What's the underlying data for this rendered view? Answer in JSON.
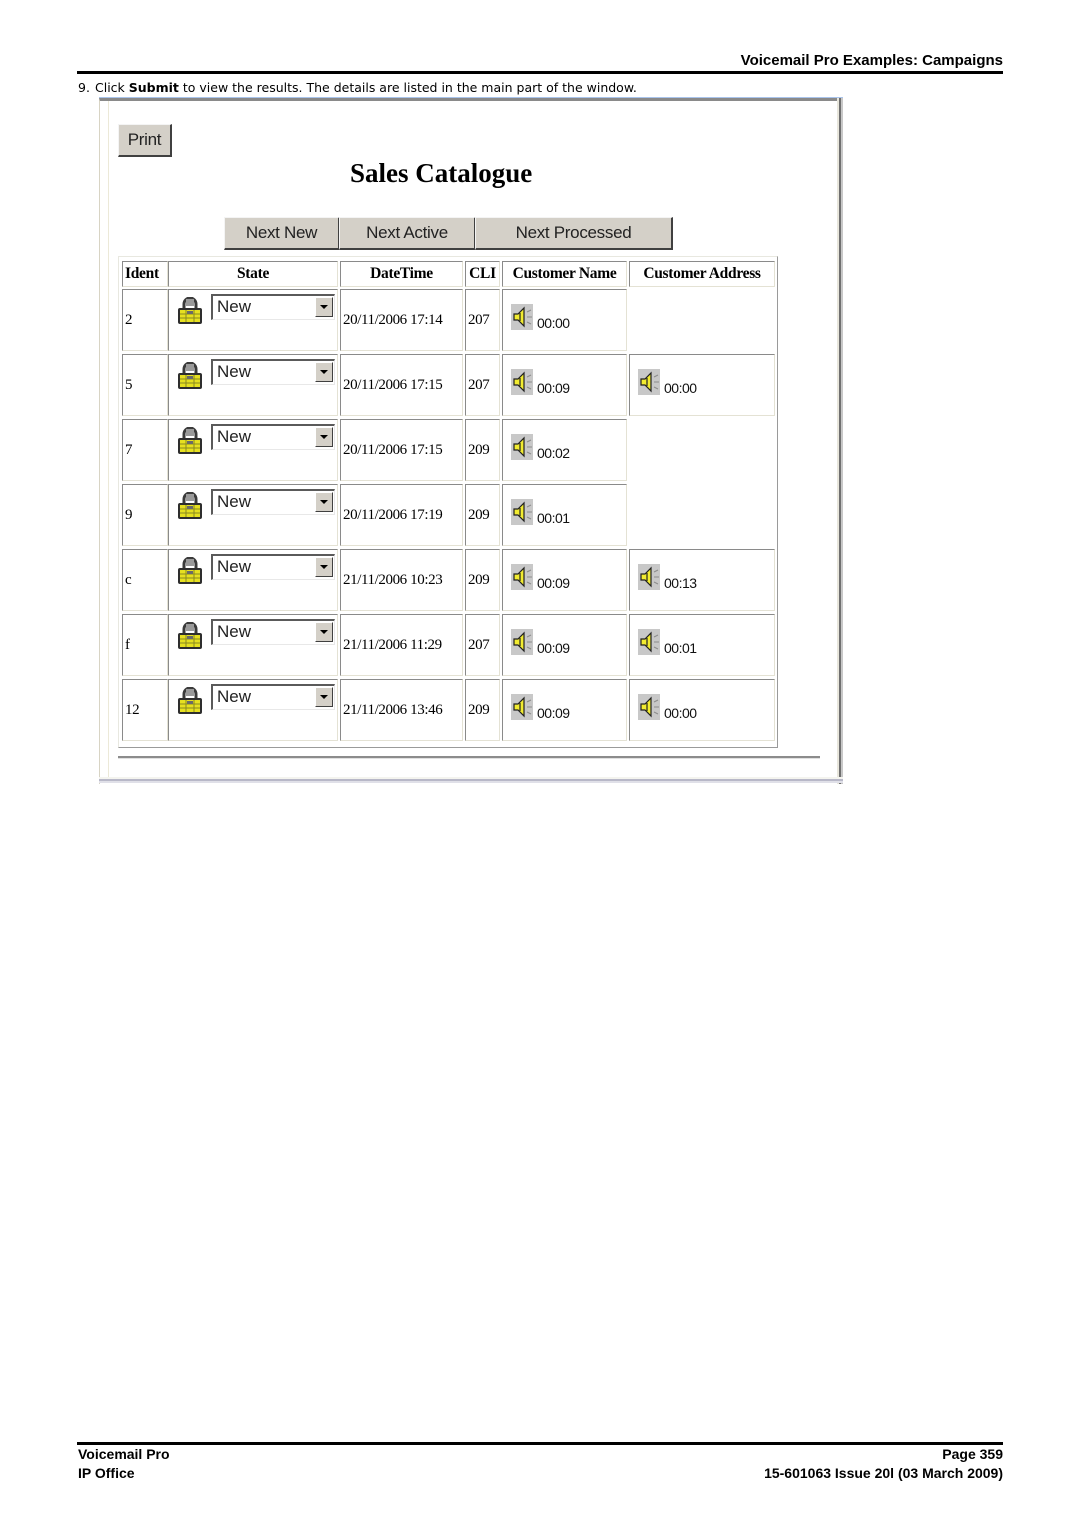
{
  "header": {
    "title": "Voicemail Pro Examples: Campaigns"
  },
  "step": {
    "number": "9.",
    "text_before": "Click ",
    "bold": "Submit",
    "text_after": " to view the results. The details are listed in the main part of the window."
  },
  "app": {
    "print_label": "Print",
    "page_title": "Sales Catalogue",
    "nav_buttons": [
      "Next New",
      "Next Active",
      "Next Processed"
    ],
    "columns": [
      "Ident",
      "State",
      "DateTime",
      "CLI",
      "Customer Name",
      "Customer Address"
    ],
    "rows": [
      {
        "ident": "2",
        "state": "New",
        "datetime": "20/11/2006 17:14",
        "cli": "207",
        "customer_name": "00:00",
        "customer_address": null
      },
      {
        "ident": "5",
        "state": "New",
        "datetime": "20/11/2006 17:15",
        "cli": "207",
        "customer_name": "00:09",
        "customer_address": "00:00"
      },
      {
        "ident": "7",
        "state": "New",
        "datetime": "20/11/2006 17:15",
        "cli": "209",
        "customer_name": "00:02",
        "customer_address": null
      },
      {
        "ident": "9",
        "state": "New",
        "datetime": "20/11/2006 17:19",
        "cli": "209",
        "customer_name": "00:01",
        "customer_address": null
      },
      {
        "ident": "c",
        "state": "New",
        "datetime": "21/11/2006 10:23",
        "cli": "209",
        "customer_name": "00:09",
        "customer_address": "00:13"
      },
      {
        "ident": "f",
        "state": "New",
        "datetime": "21/11/2006 11:29",
        "cli": "207",
        "customer_name": "00:09",
        "customer_address": "00:01"
      },
      {
        "ident": "12",
        "state": "New",
        "datetime": "21/11/2006 13:46",
        "cli": "209",
        "customer_name": "00:09",
        "customer_address": "00:00"
      }
    ],
    "icons": {
      "state": "padlock-icon",
      "recording": "speaker-icon",
      "dropdown": "chevron-down-icon"
    }
  },
  "footer": {
    "left_line1": "Voicemail Pro",
    "left_line2": "IP Office",
    "right_line1": "Page 359",
    "right_line2": "15-601063 Issue 20l (03 March 2009)"
  }
}
